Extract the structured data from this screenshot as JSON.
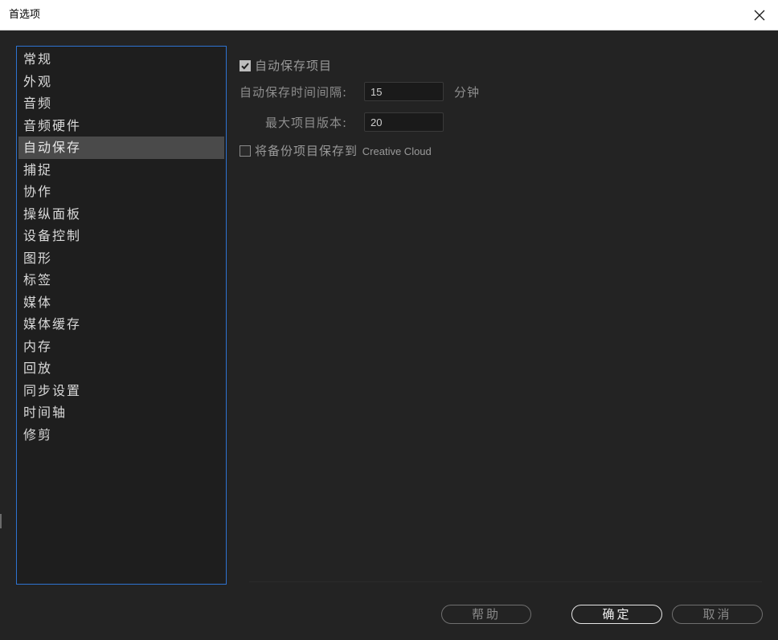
{
  "window": {
    "title": "首选项"
  },
  "sidebar": {
    "items": [
      {
        "label": "常规"
      },
      {
        "label": "外观"
      },
      {
        "label": "音频"
      },
      {
        "label": "音频硬件"
      },
      {
        "label": "自动保存",
        "selected": true
      },
      {
        "label": "捕捉"
      },
      {
        "label": "协作"
      },
      {
        "label": "操纵面板"
      },
      {
        "label": "设备控制"
      },
      {
        "label": "图形"
      },
      {
        "label": "标签"
      },
      {
        "label": "媒体"
      },
      {
        "label": "媒体缓存"
      },
      {
        "label": "内存"
      },
      {
        "label": "回放"
      },
      {
        "label": "同步设置"
      },
      {
        "label": "时间轴"
      },
      {
        "label": "修剪"
      }
    ]
  },
  "autosave": {
    "enable_label": "自动保存项目",
    "enable_checked": true,
    "interval_label": "自动保存时间间隔:",
    "interval_value": "15",
    "interval_unit": "分钟",
    "max_versions_label": "最大项目版本:",
    "max_versions_value": "20",
    "cloud_label_prefix": "将备份项目保存到 ",
    "cloud_label_brand": "Creative Cloud",
    "cloud_checked": false
  },
  "buttons": {
    "help": "帮助",
    "ok": "确定",
    "cancel": "取消"
  },
  "colors": {
    "background": "#232323",
    "sidebar_border": "#2e73d1",
    "selected_item": "#4a4a4a"
  },
  "icons": {
    "close": "close-icon",
    "check": "checkmark-icon"
  }
}
